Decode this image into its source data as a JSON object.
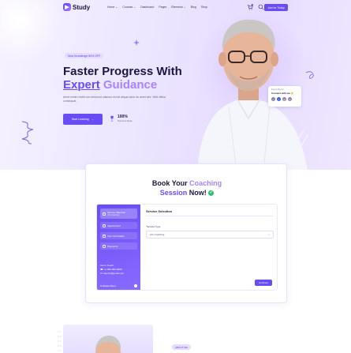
{
  "navbar": {
    "logo_text": "Study",
    "menu": [
      "Home ⌄",
      "Courses ⌄",
      "Dashboard",
      "Pages",
      "Elements ⌄",
      "Blog",
      "Shop"
    ],
    "cart_count": "0",
    "join_label": "Join for Today"
  },
  "hero": {
    "badge": "Now Knowledge 50% OFF",
    "title_line1": "Faster Progress With",
    "title_expert": "Expert",
    "title_guidance": " Guidance",
    "description": "Amet minim mollit non deserunt ullamco est sit aliqua dolor do amet sint. Velit officia consequat.",
    "start_label": "Start Learning",
    "rating_pct": "100%",
    "rating_label": "Success Rate"
  },
  "connect_card": {
    "small": "Expert Mentor",
    "title": "Connect with me 👋"
  },
  "booking": {
    "title_book": "Book Your ",
    "title_coaching": "Coaching",
    "title_session": "Session",
    "title_now": " Now!",
    "sidebar": [
      {
        "num": "1",
        "label": "Service Selection",
        "sub": "Life Coaching"
      },
      {
        "num": "2",
        "label": "Appointment"
      },
      {
        "num": "3",
        "label": "Your Information"
      },
      {
        "num": "4",
        "label": "Payments"
      }
    ],
    "contact_heading": "Get in Touch",
    "contact_phone": "+1 000-000-0000",
    "contact_email": "support@gmail.com",
    "collapse_label": "Collapse Menu",
    "form_heading": "Service Selection",
    "service_label": "Service Type",
    "service_value": "Life Coaching",
    "continue_label": "Continue"
  },
  "about": {
    "badge": "ABOUT ME"
  },
  "colors": {
    "primary": "#6a4cf5",
    "accent": "#a685ff",
    "heading": "#1c1642",
    "success": "#2fbf71"
  }
}
